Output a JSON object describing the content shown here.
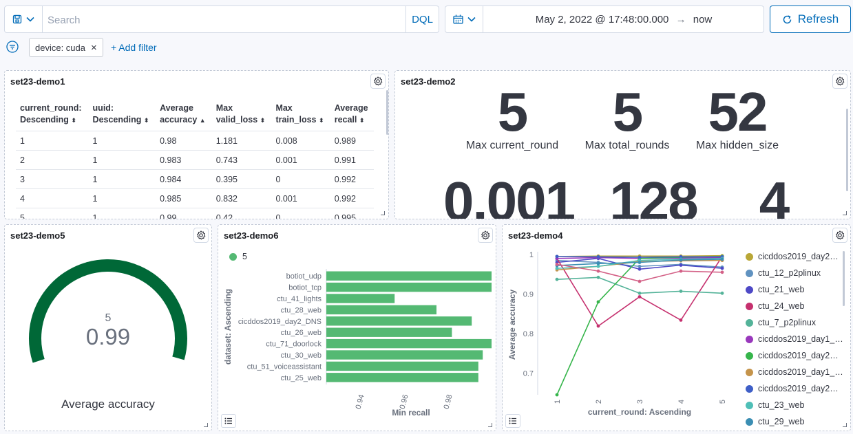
{
  "query": {
    "placeholder": "Search",
    "language": "DQL"
  },
  "time": {
    "start": "May 2, 2022 @ 17:48:00.000",
    "arrow": "→",
    "end": "now"
  },
  "refresh_label": "Refresh",
  "filters": [
    {
      "label": "device: cuda",
      "remove": "×"
    }
  ],
  "add_filter": "+ Add filter",
  "panels": {
    "demo1": {
      "title": "set23-demo1",
      "headers": [
        [
          "current_round:",
          "Descending"
        ],
        [
          "uuid:",
          "Descending"
        ],
        [
          "Average",
          "accuracy"
        ],
        [
          "Max",
          "valid_loss"
        ],
        [
          "Max",
          "train_loss"
        ],
        [
          "Average",
          "recall"
        ]
      ],
      "sort_icons": [
        "⬍",
        "⬍",
        "▲",
        "⬍",
        "⬍",
        "⬍"
      ],
      "rows": [
        [
          "1",
          "1",
          "0.98",
          "1.181",
          "0.008",
          "0.989"
        ],
        [
          "2",
          "1",
          "0.983",
          "0.743",
          "0.001",
          "0.991"
        ],
        [
          "3",
          "1",
          "0.984",
          "0.395",
          "0",
          "0.992"
        ],
        [
          "4",
          "1",
          "0.985",
          "0.832",
          "0.001",
          "0.992"
        ],
        [
          "5",
          "1",
          "0.99",
          "0.42",
          "0",
          "0.995"
        ]
      ]
    },
    "demo2": {
      "title": "set23-demo2",
      "metrics": [
        {
          "value": "5",
          "label": "Max current_round"
        },
        {
          "value": "5",
          "label": "Max total_rounds"
        },
        {
          "value": "52",
          "label": "Max hidden_size"
        },
        {
          "value": "0.001",
          "label": ""
        },
        {
          "value": "128",
          "label": ""
        },
        {
          "value": "4",
          "label": ""
        }
      ]
    },
    "demo5": {
      "title": "set23-demo5",
      "gauge_sub": "5",
      "gauge_value": "0.99",
      "gauge_label": "Average accuracy",
      "gauge_fraction": 0.99,
      "color": "#006837"
    },
    "demo6": {
      "title": "set23-demo6",
      "legend_item": "5",
      "color": "#54b973"
    },
    "demo4": {
      "title": "set23-demo4",
      "legend": [
        {
          "name": "cicddos2019_day2…",
          "color": "#b9a737"
        },
        {
          "name": "ctu_12_p2plinux",
          "color": "#6092c0"
        },
        {
          "name": "ctu_21_web",
          "color": "#4e49c6"
        },
        {
          "name": "ctu_24_web",
          "color": "#c5306e"
        },
        {
          "name": "ctu_7_p2plinux",
          "color": "#54b399"
        },
        {
          "name": "cicddos2019_day1_…",
          "color": "#9938bc"
        },
        {
          "name": "cicddos2019_day2…",
          "color": "#36b54b"
        },
        {
          "name": "cicddos2019_day1_…",
          "color": "#c5944b"
        },
        {
          "name": "cicddos2019_day2…",
          "color": "#3f5fc7"
        },
        {
          "name": "ctu_23_web",
          "color": "#4fbfb7"
        },
        {
          "name": "ctu_29_web",
          "color": "#3b8eb3"
        }
      ]
    }
  },
  "chart_data": [
    {
      "type": "bar",
      "orientation": "horizontal",
      "categories": [
        "botiot_udp",
        "botiot_tcp",
        "ctu_41_lights",
        "ctu_28_web",
        "cicddos2019_day2_DNS",
        "ctu_26_web",
        "ctu_71_doorlock",
        "ctu_30_web",
        "ctu_51_voiceassistant",
        "ctu_25_web"
      ],
      "series": [
        {
          "name": "5",
          "values": [
            1.0,
            1.0,
            0.956,
            0.975,
            0.991,
            0.982,
            1.0,
            0.996,
            0.994,
            0.994
          ]
        }
      ],
      "xlabel": "Min recall",
      "ylabel": "dataset: Ascending",
      "xticks": [
        "0.94",
        "0.96",
        "0.98"
      ],
      "xlim": [
        0.925,
        1.0
      ]
    },
    {
      "type": "line",
      "x": [
        1,
        2,
        3,
        4,
        5
      ],
      "xlabel": "current_round: Ascending",
      "ylabel": "Average accuracy",
      "yticks": [
        "0.7",
        "0.8",
        "0.9",
        "1"
      ],
      "ylim": [
        0.645,
        1.0
      ],
      "series": [
        {
          "name": "cicddos2019_day2…",
          "values": [
            0.995,
            0.996,
            0.996,
            0.996,
            0.997
          ]
        },
        {
          "name": "ctu_12_p2plinux",
          "values": [
            0.985,
            0.98,
            0.97,
            0.975,
            0.968
          ]
        },
        {
          "name": "ctu_21_web",
          "values": [
            0.98,
            0.99,
            0.963,
            0.973,
            0.965
          ]
        },
        {
          "name": "ctu_24_web",
          "values": [
            0.99,
            0.819,
            0.893,
            0.834,
            0.995
          ]
        },
        {
          "name": "ctu_7_p2plinux",
          "values": [
            0.937,
            0.942,
            0.902,
            0.907,
            0.902
          ]
        },
        {
          "name": "cicddos2019_day1_…",
          "values": [
            0.99,
            0.992,
            0.99,
            0.991,
            0.992
          ]
        },
        {
          "name": "cicddos2019_day2…",
          "values": [
            0.645,
            0.88,
            0.99,
            0.993,
            0.995
          ]
        },
        {
          "name": "cicddos2019_day1_…",
          "values": [
            0.961,
            0.97,
            0.982,
            0.984,
            0.985
          ]
        },
        {
          "name": "cicddos2019_day2…",
          "values": [
            0.995,
            0.994,
            0.993,
            0.994,
            0.994
          ]
        },
        {
          "name": "ctu_23_web",
          "values": [
            0.965,
            0.97,
            0.985,
            0.988,
            0.99
          ]
        },
        {
          "name": "ctu_29_web",
          "values": [
            0.972,
            0.977,
            0.98,
            0.986,
            0.988
          ]
        },
        {
          "name": "",
          "values": [
            0.975,
            0.958,
            0.932,
            0.958,
            0.955
          ]
        }
      ]
    }
  ]
}
